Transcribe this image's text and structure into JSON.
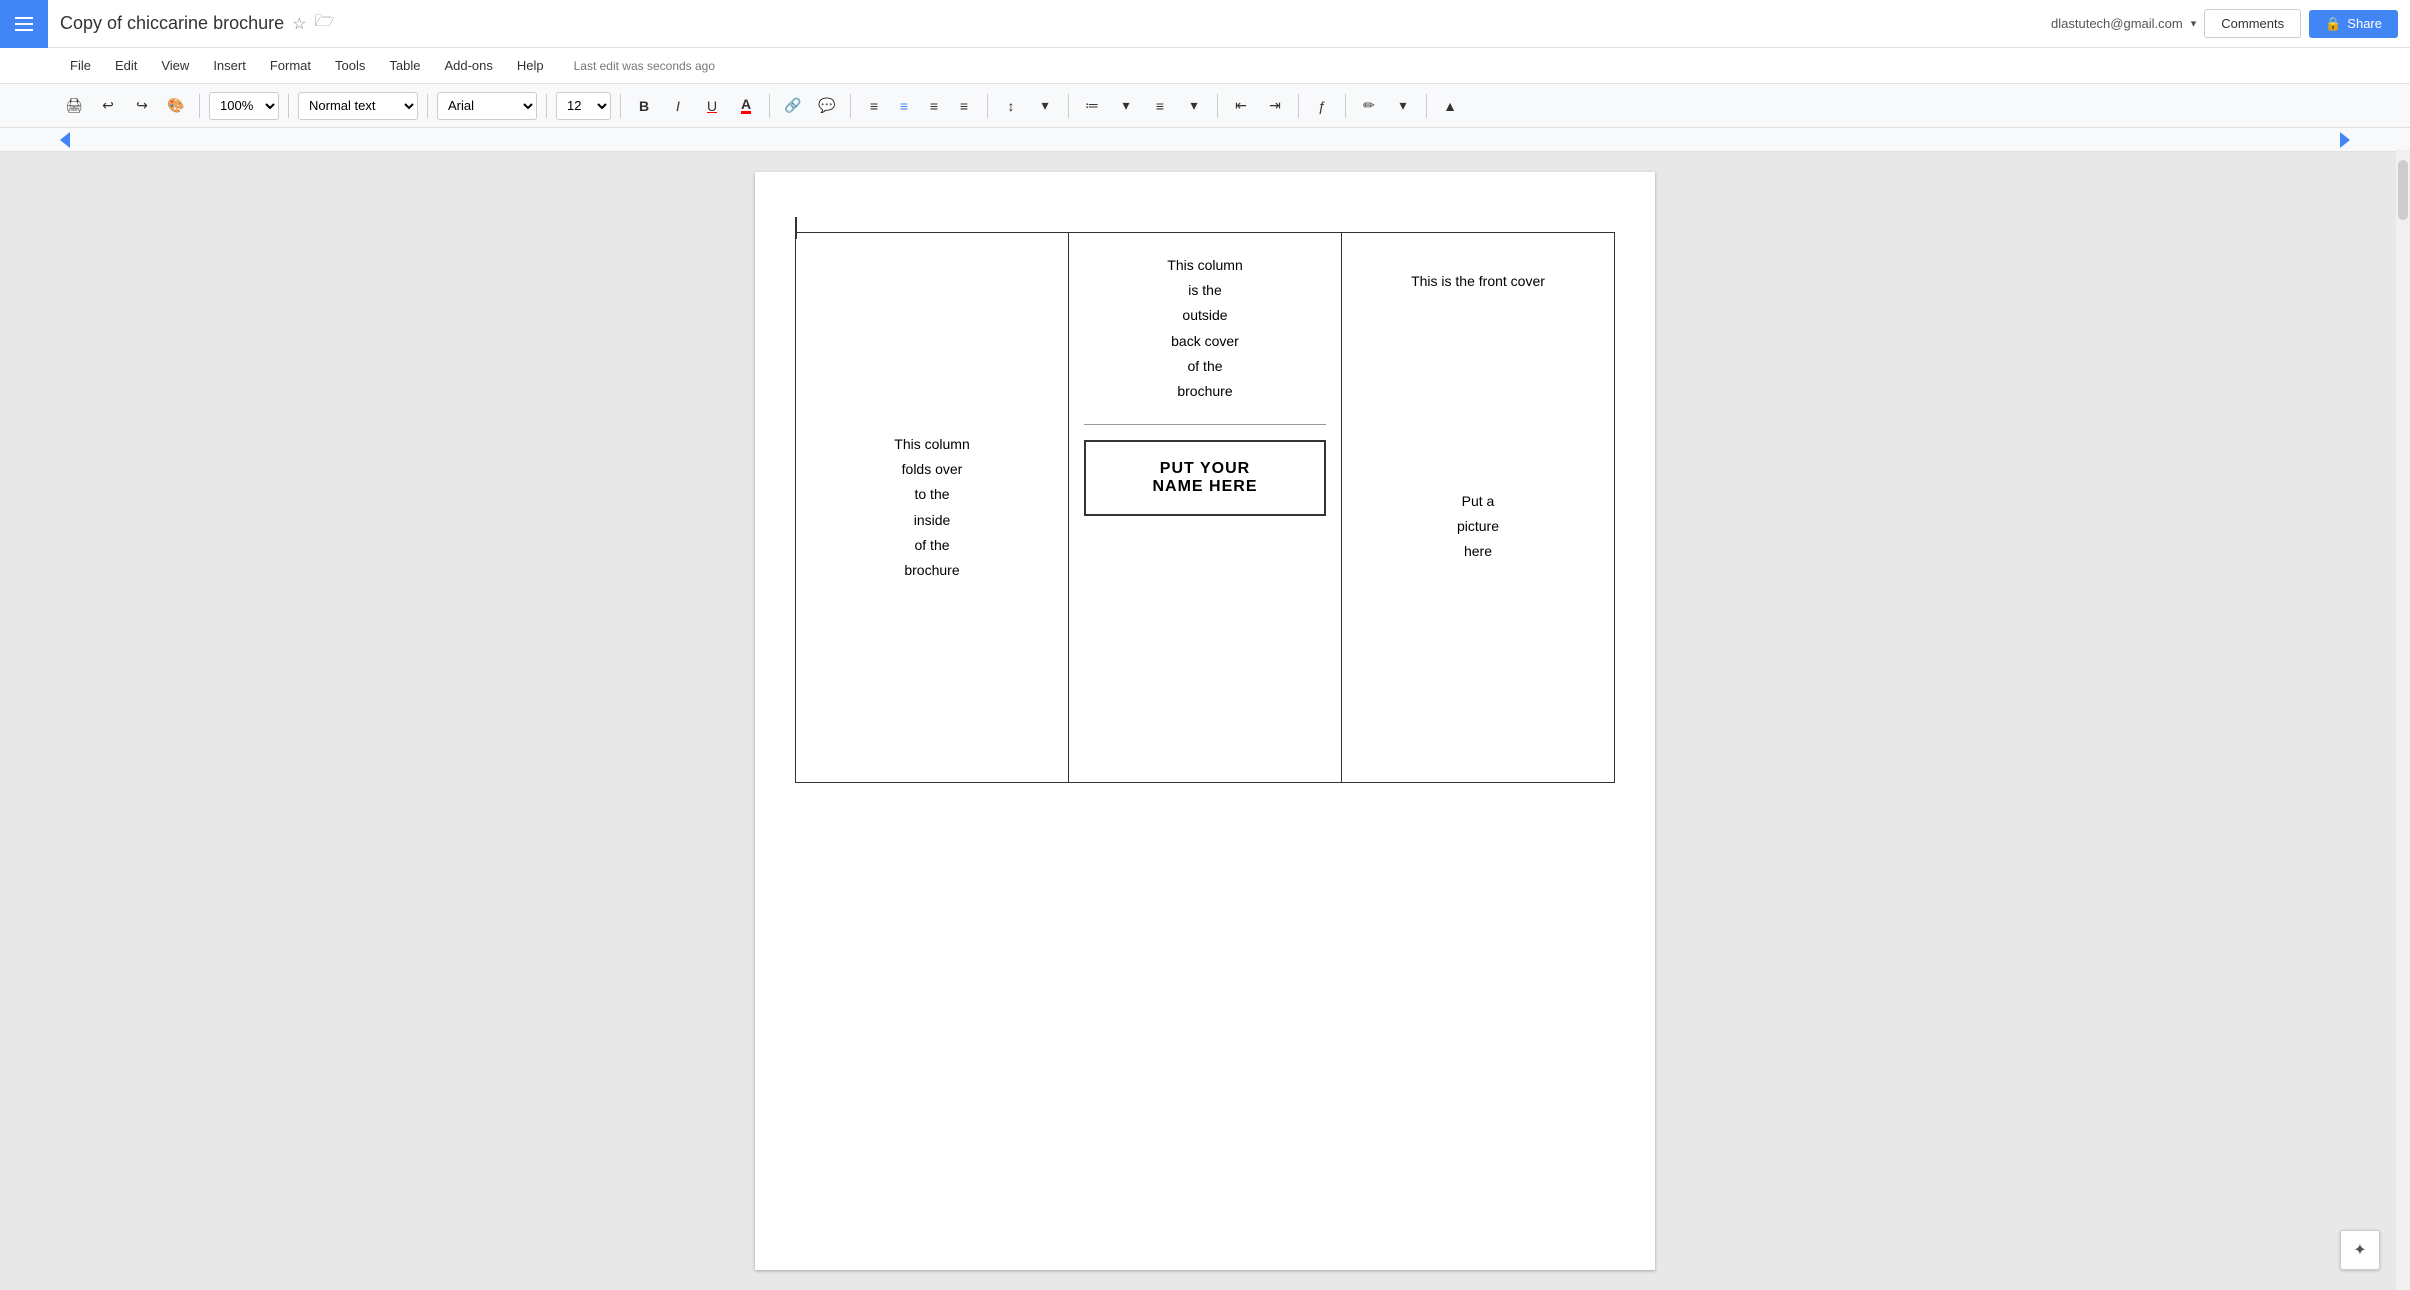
{
  "topbar": {
    "doc_title": "Copy of chiccarine brochure",
    "user_email": "dlastutech@gmail.com",
    "comments_label": "Comments",
    "share_label": "Share",
    "share_icon": "🔒"
  },
  "menubar": {
    "items": [
      "File",
      "Edit",
      "View",
      "Insert",
      "Format",
      "Tools",
      "Table",
      "Add-ons",
      "Help"
    ],
    "last_edit": "Last edit was seconds ago"
  },
  "toolbar": {
    "zoom": "100%",
    "style": "Normal text",
    "font": "Arial",
    "size": "12",
    "print_icon": "🖨",
    "undo_icon": "↩",
    "redo_icon": "↪"
  },
  "document": {
    "col_left_text": "This column\nfolds over\nto the\ninside\nof the\nbrochure",
    "col_middle_text": "This column\nis the\noutside\nback cover\nof the\nbrochure",
    "name_box_text": "PUT YOUR\nNAME HERE",
    "front_cover_title": "This is the front cover",
    "front_cover_picture": "Put a\npicture\nhere"
  }
}
